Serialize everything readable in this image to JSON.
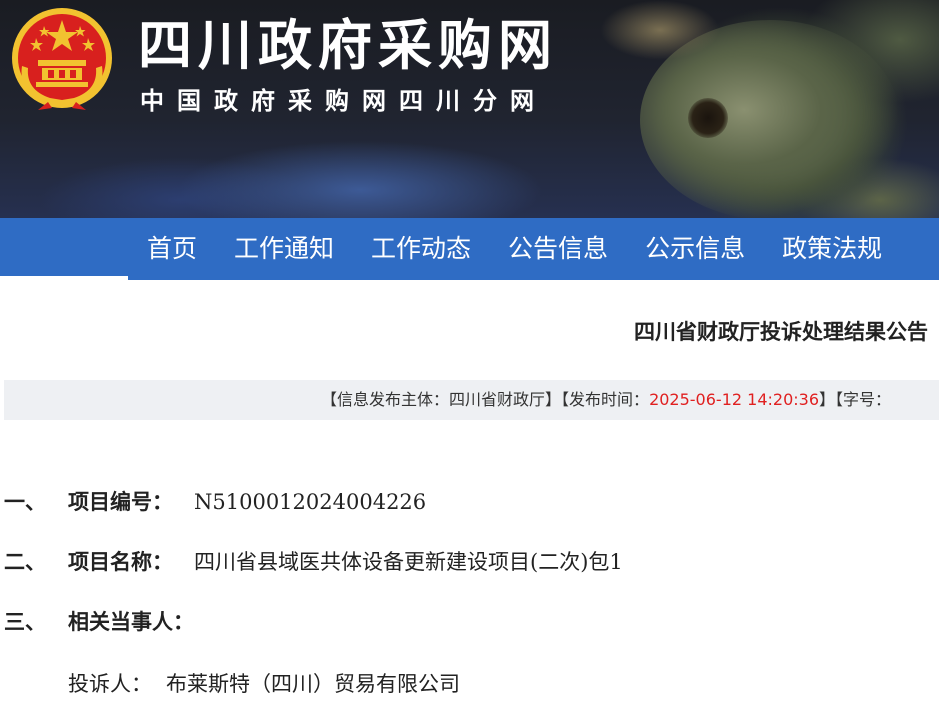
{
  "banner": {
    "title": "四川政府采购网",
    "subtitle": "中国政府采购网四川分网",
    "emblem_icon": "national-emblem-icon"
  },
  "nav": {
    "items": [
      "首页",
      "工作通知",
      "工作动态",
      "公告信息",
      "公示信息",
      "政策法规"
    ]
  },
  "article": {
    "title": "四川省财政厅投诉处理结果公告",
    "meta": {
      "publisher_label": "【信息发布主体：",
      "publisher": "四川省财政厅",
      "publisher_close": "】",
      "time_label": "【发布时间：",
      "time": "2025-06-12 14:20:36",
      "time_close": "】",
      "font_label": "【字号："
    },
    "sections": [
      {
        "num": "一、",
        "label": "项目编号：",
        "value": "N5100012024004226"
      },
      {
        "num": "二、",
        "label": "项目名称：",
        "value": "四川省县域医共体设备更新建设项目(二次)包1"
      },
      {
        "num": "三、",
        "label": "相关当事人：",
        "value": ""
      }
    ],
    "party": {
      "label": "投诉人：",
      "value": "布莱斯特（四川）贸易有限公司"
    }
  },
  "colors": {
    "nav_bg": "#2f6cc4",
    "meta_bg": "#eef0f3",
    "highlight_red": "#e02020",
    "emblem_red": "#d8201e",
    "emblem_gold": "#f2c230"
  }
}
